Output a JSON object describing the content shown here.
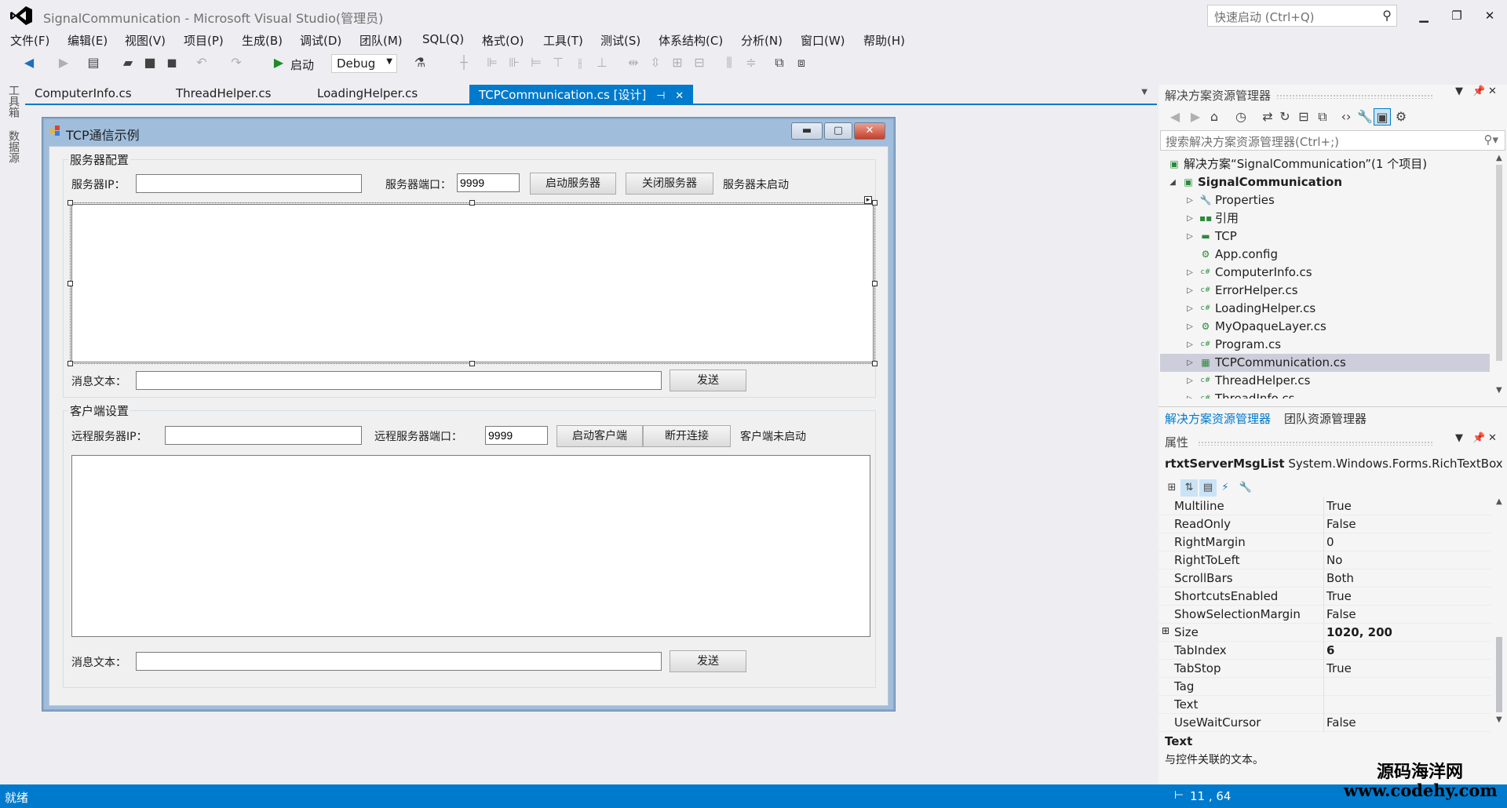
{
  "app": {
    "title": "SignalCommunication - Microsoft Visual Studio(管理员)",
    "quick_launch_placeholder": "快速启动 (Ctrl+Q)"
  },
  "menu": [
    "文件(F)",
    "编辑(E)",
    "视图(V)",
    "项目(P)",
    "生成(B)",
    "调试(D)",
    "团队(M)",
    "SQL(Q)",
    "格式(O)",
    "工具(T)",
    "测试(S)",
    "体系结构(C)",
    "分析(N)",
    "窗口(W)",
    "帮助(H)"
  ],
  "toolbar": {
    "start_label": "启动",
    "config_value": "Debug"
  },
  "left_rail": [
    "工具箱",
    "数据源"
  ],
  "doc_tabs": [
    {
      "label": "ComputerInfo.cs",
      "active": false
    },
    {
      "label": "ThreadHelper.cs",
      "active": false
    },
    {
      "label": "LoadingHelper.cs",
      "active": false
    },
    {
      "label": "TCPCommunication.cs [设计]",
      "active": true
    }
  ],
  "form": {
    "title": "TCP通信示例",
    "server_group": {
      "legend": "服务器配置",
      "ip_label": "服务器IP：",
      "ip_value": "",
      "port_label": "服务器端口：",
      "port_value": "9999",
      "start_button": "启动服务器",
      "stop_button": "关闭服务器",
      "status": "服务器未启动",
      "msg_label": "消息文本：",
      "msg_value": "",
      "send_button": "发送"
    },
    "client_group": {
      "legend": "客户端设置",
      "ip_label": "远程服务器IP：",
      "ip_value": "",
      "port_label": "远程服务器端口：",
      "port_value": "9999",
      "start_button": "启动客户端",
      "disconnect_button": "断开连接",
      "status": "客户端未启动",
      "msg_label": "消息文本：",
      "msg_value": "",
      "send_button": "发送"
    }
  },
  "solution_explorer": {
    "title": "解决方案资源管理器",
    "search_placeholder": "搜索解决方案资源管理器(Ctrl+;)",
    "items": [
      {
        "label": "解决方案“SignalCommunication”(1 个项目)",
        "level": 0,
        "arrow": "",
        "icon": "solution-icon",
        "glyph": "▣",
        "bold": false
      },
      {
        "label": "SignalCommunication",
        "level": 1,
        "arrow": "◢",
        "icon": "csharp-project-icon",
        "glyph": "▣",
        "bold": true
      },
      {
        "label": "Properties",
        "level": 2,
        "arrow": "▷",
        "icon": "wrench-icon",
        "glyph": "🔧",
        "bold": false
      },
      {
        "label": "引用",
        "level": 2,
        "arrow": "▷",
        "icon": "references-icon",
        "glyph": "▪▪",
        "bold": false
      },
      {
        "label": "TCP",
        "level": 2,
        "arrow": "▷",
        "icon": "folder-icon",
        "glyph": "▬",
        "bold": false
      },
      {
        "label": "App.config",
        "level": 2,
        "arrow": "",
        "icon": "config-file-icon",
        "glyph": "⚙",
        "bold": false
      },
      {
        "label": "ComputerInfo.cs",
        "level": 2,
        "arrow": "▷",
        "icon": "csharp-file-icon",
        "glyph": "c#",
        "bold": false
      },
      {
        "label": "ErrorHelper.cs",
        "level": 2,
        "arrow": "▷",
        "icon": "csharp-file-icon",
        "glyph": "c#",
        "bold": false
      },
      {
        "label": "LoadingHelper.cs",
        "level": 2,
        "arrow": "▷",
        "icon": "csharp-file-icon",
        "glyph": "c#",
        "bold": false
      },
      {
        "label": "MyOpaqueLayer.cs",
        "level": 2,
        "arrow": "▷",
        "icon": "component-file-icon",
        "glyph": "⚙",
        "bold": false
      },
      {
        "label": "Program.cs",
        "level": 2,
        "arrow": "▷",
        "icon": "csharp-file-icon",
        "glyph": "c#",
        "bold": false
      },
      {
        "label": "TCPCommunication.cs",
        "level": 2,
        "arrow": "▷",
        "icon": "form-file-icon",
        "glyph": "▦",
        "bold": false,
        "selected": true
      },
      {
        "label": "ThreadHelper.cs",
        "level": 2,
        "arrow": "▷",
        "icon": "csharp-file-icon",
        "glyph": "c#",
        "bold": false
      },
      {
        "label": "ThreadInfo.cs",
        "level": 2,
        "arrow": "▷",
        "icon": "csharp-file-icon",
        "glyph": "c#",
        "bold": false
      }
    ],
    "bottom_tabs": [
      "解决方案资源管理器",
      "团队资源管理器"
    ]
  },
  "properties": {
    "title": "属性",
    "object_name": "rtxtServerMsgList",
    "object_type": "System.Windows.Forms.RichTextBox",
    "rows": [
      {
        "name": "Multiline",
        "value": "True",
        "bold": false,
        "expand": ""
      },
      {
        "name": "ReadOnly",
        "value": "False",
        "bold": false,
        "expand": ""
      },
      {
        "name": "RightMargin",
        "value": "0",
        "bold": false,
        "expand": ""
      },
      {
        "name": "RightToLeft",
        "value": "No",
        "bold": false,
        "expand": ""
      },
      {
        "name": "ScrollBars",
        "value": "Both",
        "bold": false,
        "expand": ""
      },
      {
        "name": "ShortcutsEnabled",
        "value": "True",
        "bold": false,
        "expand": ""
      },
      {
        "name": "ShowSelectionMargin",
        "value": "False",
        "bold": false,
        "expand": ""
      },
      {
        "name": "Size",
        "value": "1020, 200",
        "bold": true,
        "expand": "⊞"
      },
      {
        "name": "TabIndex",
        "value": "6",
        "bold": true,
        "expand": ""
      },
      {
        "name": "TabStop",
        "value": "True",
        "bold": false,
        "expand": ""
      },
      {
        "name": "Tag",
        "value": "",
        "bold": false,
        "expand": ""
      },
      {
        "name": "Text",
        "value": "",
        "bold": false,
        "expand": ""
      },
      {
        "name": "UseWaitCursor",
        "value": "False",
        "bold": false,
        "expand": ""
      }
    ],
    "description_title": "Text",
    "description_text": "与控件关联的文本。"
  },
  "status": {
    "text": "就绪",
    "position": "11 , 64"
  },
  "watermark": {
    "line1": "源码海洋网",
    "line2": "www.codehy.com"
  },
  "colors": {
    "accent": "#007acc",
    "selected_row": "#cccedb",
    "form_border": "#a0bedc"
  }
}
